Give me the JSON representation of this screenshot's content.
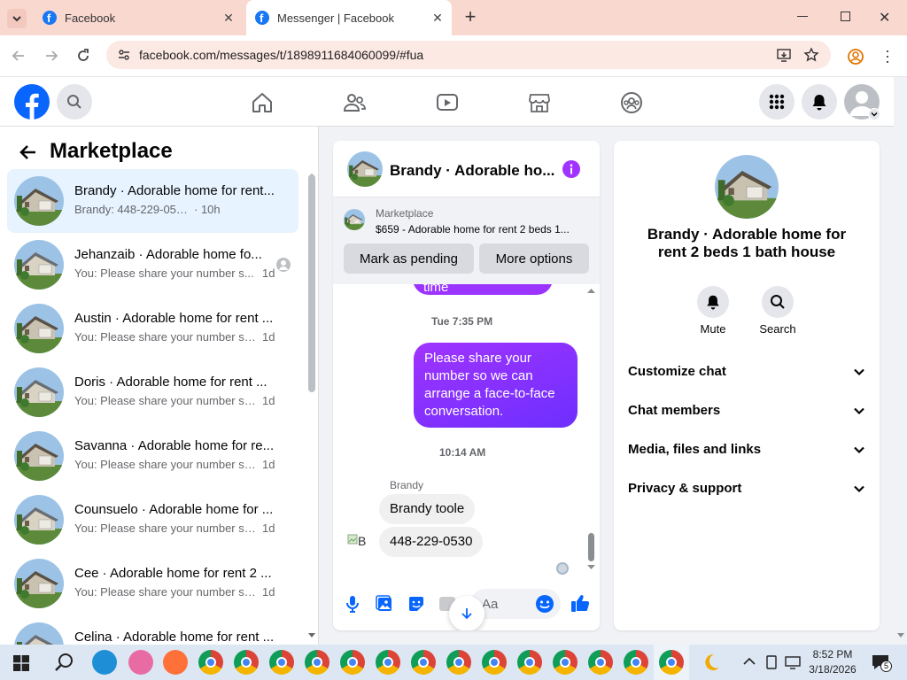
{
  "browser": {
    "tabs": [
      {
        "title": "Facebook"
      },
      {
        "title": "Messenger | Facebook"
      }
    ],
    "url": "facebook.com/messages/t/1898911684060099/#fua"
  },
  "sidebar": {
    "title": "Marketplace",
    "conversations": [
      {
        "title": "Brandy · Adorable home for rent...",
        "snippet": "Brandy: 448-229-0530",
        "time": "· 10h",
        "active": true
      },
      {
        "title": "Jehanzaib · Adorable home fo...",
        "snippet": "You: Please share your number s...",
        "time": "1d"
      },
      {
        "title": "Austin · Adorable home for rent ...",
        "snippet": "You: Please share your number so ...",
        "time": "1d"
      },
      {
        "title": "Doris · Adorable home for rent ...",
        "snippet": "You: Please share your number so ...",
        "time": "1d"
      },
      {
        "title": "Savanna · Adorable home for re...",
        "snippet": "You: Please share your number so ...",
        "time": "1d"
      },
      {
        "title": "Counsuelo · Adorable home for ...",
        "snippet": "You: Please share your number so ...",
        "time": "1d"
      },
      {
        "title": "Cee · Adorable home for rent 2 ...",
        "snippet": "You: Please share your number so ...",
        "time": "1d"
      },
      {
        "title": "Celina · Adorable home for rent ...",
        "snippet": "",
        "time": ""
      }
    ]
  },
  "chat": {
    "title": "Brandy · Adorable ho...",
    "marketplace_label": "Marketplace",
    "listing": "$659 - Adorable home for rent 2 beds 1...",
    "mark_pending": "Mark as pending",
    "more_options": "More options",
    "partial_bubble": "and arrange the time",
    "time1": "Tue 7:35 PM",
    "out_message": "Please share your number so we can arrange a face-to-face conversation.",
    "time2": "10:14 AM",
    "sender": "Brandy",
    "in_message1": "Brandy toole",
    "in_message2": "448-229-0530",
    "avatar_alt": "B",
    "composer_placeholder": "Aa"
  },
  "info": {
    "name": "Brandy · Adorable home for rent 2 beds 1 bath house",
    "mute": "Mute",
    "search": "Search",
    "sections": [
      "Customize chat",
      "Chat members",
      "Media, files and links",
      "Privacy & support"
    ]
  },
  "taskbar": {
    "time": "8:52 PM",
    "date": "3/18/2026",
    "notifications": "5"
  }
}
